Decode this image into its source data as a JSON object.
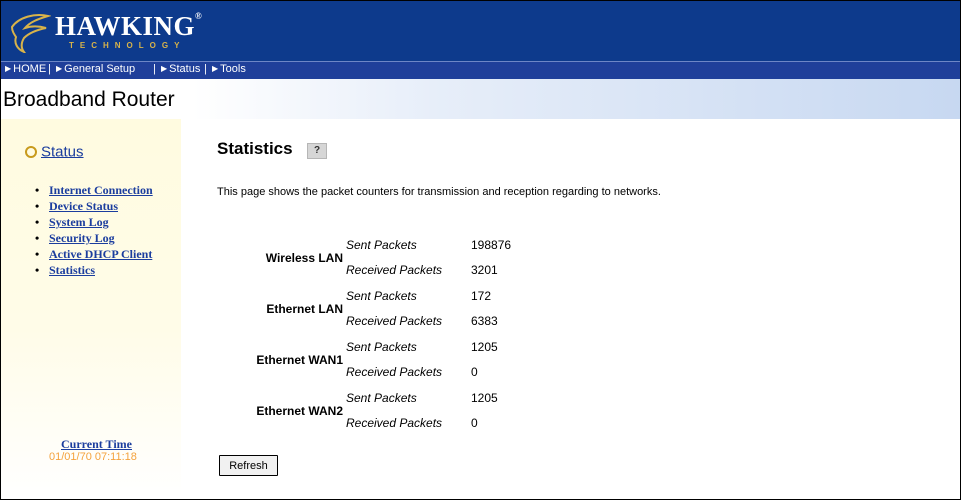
{
  "header": {
    "logo_word": "HAWKING",
    "logo_reg": "®",
    "logo_sub": "TECHNOLOGY"
  },
  "nav": {
    "items": [
      {
        "label": "HOME"
      },
      {
        "label": "General Setup"
      },
      {
        "label": "Status"
      },
      {
        "label": "Tools"
      }
    ],
    "separator": "|"
  },
  "band": {
    "title": "Broadband Router"
  },
  "sidebar": {
    "title": "Status",
    "items": [
      {
        "label": "Internet Connection"
      },
      {
        "label": "Device Status"
      },
      {
        "label": "System Log"
      },
      {
        "label": "Security Log"
      },
      {
        "label": "Active DHCP Client"
      },
      {
        "label": "Statistics"
      }
    ],
    "time_label": "Current Time",
    "time_value": "01/01/70 07:11:18"
  },
  "main": {
    "title": "Statistics",
    "help": "?",
    "description": "This page shows the packet counters for transmission and reception regarding to networks.",
    "stats": [
      {
        "iface": "Wireless LAN",
        "rows": [
          {
            "label": "Sent Packets",
            "value": "198876"
          },
          {
            "label": "Received Packets",
            "value": "3201"
          }
        ]
      },
      {
        "iface": "Ethernet LAN",
        "rows": [
          {
            "label": "Sent Packets",
            "value": "172"
          },
          {
            "label": "Received Packets",
            "value": "6383"
          }
        ]
      },
      {
        "iface": "Ethernet WAN1",
        "rows": [
          {
            "label": "Sent Packets",
            "value": "1205"
          },
          {
            "label": "Received Packets",
            "value": "0"
          }
        ]
      },
      {
        "iface": "Ethernet WAN2",
        "rows": [
          {
            "label": "Sent Packets",
            "value": "1205"
          },
          {
            "label": "Received Packets",
            "value": "0"
          }
        ]
      }
    ],
    "refresh_label": "Refresh"
  },
  "colors": {
    "header_bg": "#0d3a8c",
    "nav_bg": "#1f3f9a",
    "link": "#1b3d9e",
    "time_value": "#f4a23d",
    "logo_gold": "#d8b34a"
  }
}
